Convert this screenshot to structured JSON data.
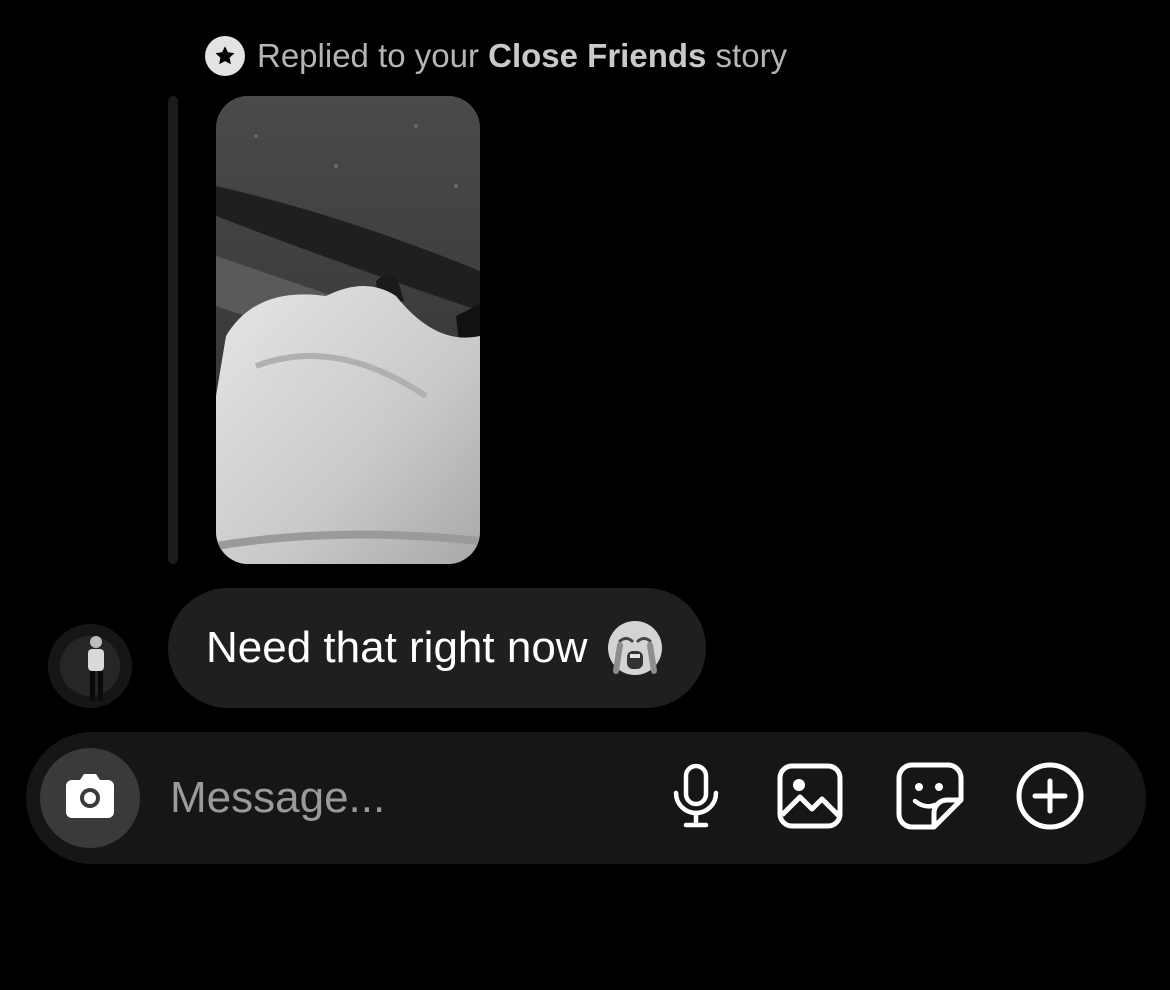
{
  "reply_context": {
    "prefix": "Replied to your ",
    "audience": "Close Friends",
    "suffix": " story",
    "icon": "star-icon"
  },
  "story": {
    "icon": "story-thumbnail"
  },
  "message": {
    "text": "Need that right now",
    "emoji": "loudly-crying-face-emoji",
    "sender_avatar": "avatar"
  },
  "composer": {
    "placeholder": "Message...",
    "camera_icon": "camera-icon",
    "mic_icon": "microphone-icon",
    "gallery_icon": "gallery-icon",
    "sticker_icon": "sticker-icon",
    "add_icon": "plus-circle-icon"
  },
  "colors": {
    "background": "#000000",
    "bubble": "#1f1f1f",
    "composer": "#161616",
    "camera_button": "#3a3a3a"
  }
}
